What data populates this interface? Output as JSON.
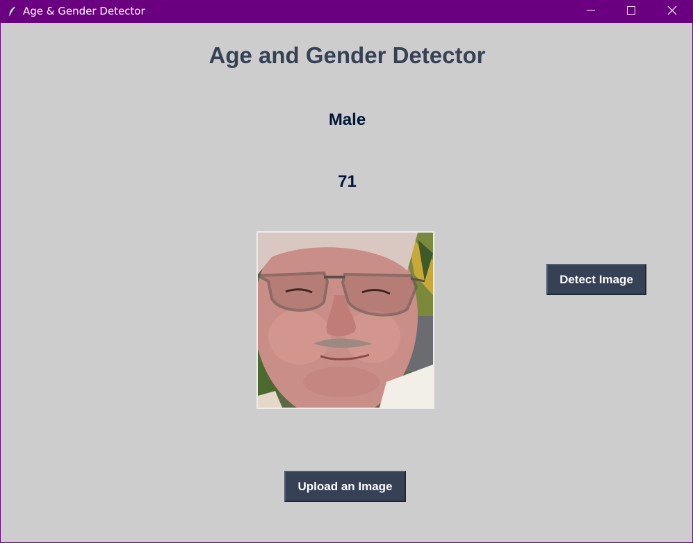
{
  "window": {
    "title": "Age & Gender Detector",
    "titlebar_color": "#6a0080",
    "background_color": "#cdcdcd",
    "icons": {
      "app": "feather-icon",
      "minimize": "minimize-icon",
      "maximize": "maximize-icon",
      "close": "close-icon"
    }
  },
  "main": {
    "heading": "Age and Gender Detector",
    "gender_result": "Male",
    "age_result": "71",
    "photo_description": "Uploaded face photo",
    "detect_button_label": "Detect Image",
    "upload_button_label": "Upload an Image",
    "heading_color": "#364156",
    "result_color": "#011638",
    "button_color": "#364156"
  }
}
